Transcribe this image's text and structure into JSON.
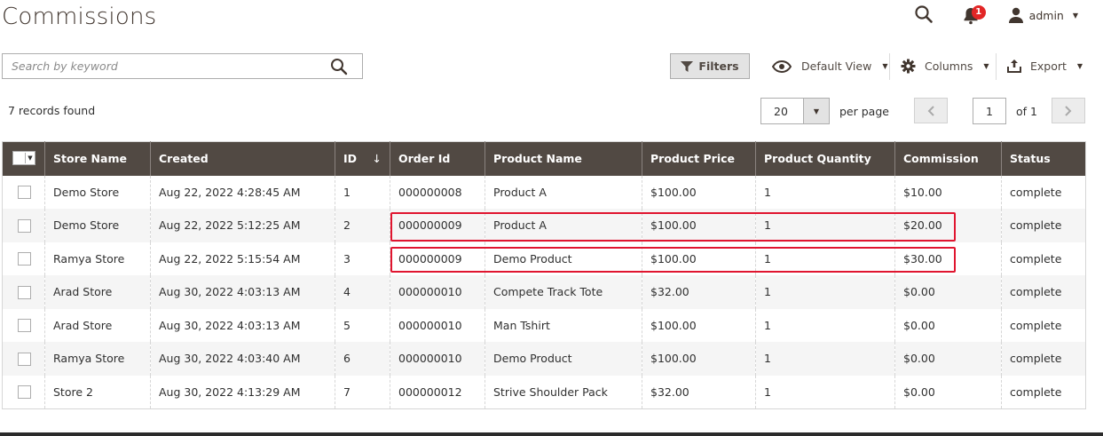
{
  "page": {
    "title": "Commissions"
  },
  "header": {
    "notification_count": "1",
    "user_name": "admin"
  },
  "search": {
    "placeholder": "Search by keyword",
    "value": ""
  },
  "toolbar": {
    "filters_label": "Filters",
    "view_label": "Default View",
    "columns_label": "Columns",
    "export_label": "Export"
  },
  "pagination": {
    "records_text": "7 records found",
    "per_page_value": "20",
    "per_page_label": "per page",
    "current_page": "1",
    "of_label": "of 1"
  },
  "grid": {
    "columns": [
      "Store Name",
      "Created",
      "ID",
      "Order Id",
      "Product Name",
      "Product Price",
      "Product Quantity",
      "Commission",
      "Status"
    ],
    "sort_indicator": "↓",
    "rows": [
      [
        "Demo Store",
        "Aug 22, 2022 4:28:45 AM",
        "1",
        "000000008",
        "Product A",
        "$100.00",
        "1",
        "$10.00",
        "complete"
      ],
      [
        "Demo Store",
        "Aug 22, 2022 5:12:25 AM",
        "2",
        "000000009",
        "Product A",
        "$100.00",
        "1",
        "$20.00",
        "complete"
      ],
      [
        "Ramya Store",
        "Aug 22, 2022 5:15:54 AM",
        "3",
        "000000009",
        "Demo Product",
        "$100.00",
        "1",
        "$30.00",
        "complete"
      ],
      [
        "Arad Store",
        "Aug 30, 2022 4:03:13 AM",
        "4",
        "000000010",
        "Compete Track Tote",
        "$32.00",
        "1",
        "$0.00",
        "complete"
      ],
      [
        "Arad Store",
        "Aug 30, 2022 4:03:13 AM",
        "5",
        "000000010",
        "Man Tshirt",
        "$100.00",
        "1",
        "$0.00",
        "complete"
      ],
      [
        "Ramya Store",
        "Aug 30, 2022 4:03:40 AM",
        "6",
        "000000010",
        "Demo Product",
        "$100.00",
        "1",
        "$0.00",
        "complete"
      ],
      [
        "Store 2",
        "Aug 30, 2022 4:13:29 AM",
        "7",
        "000000012",
        "Strive Shoulder Pack",
        "$32.00",
        "1",
        "$0.00",
        "complete"
      ]
    ]
  },
  "colors": {
    "header_bg": "#514943",
    "highlight": "#e0152f",
    "badge": "#e22626"
  }
}
